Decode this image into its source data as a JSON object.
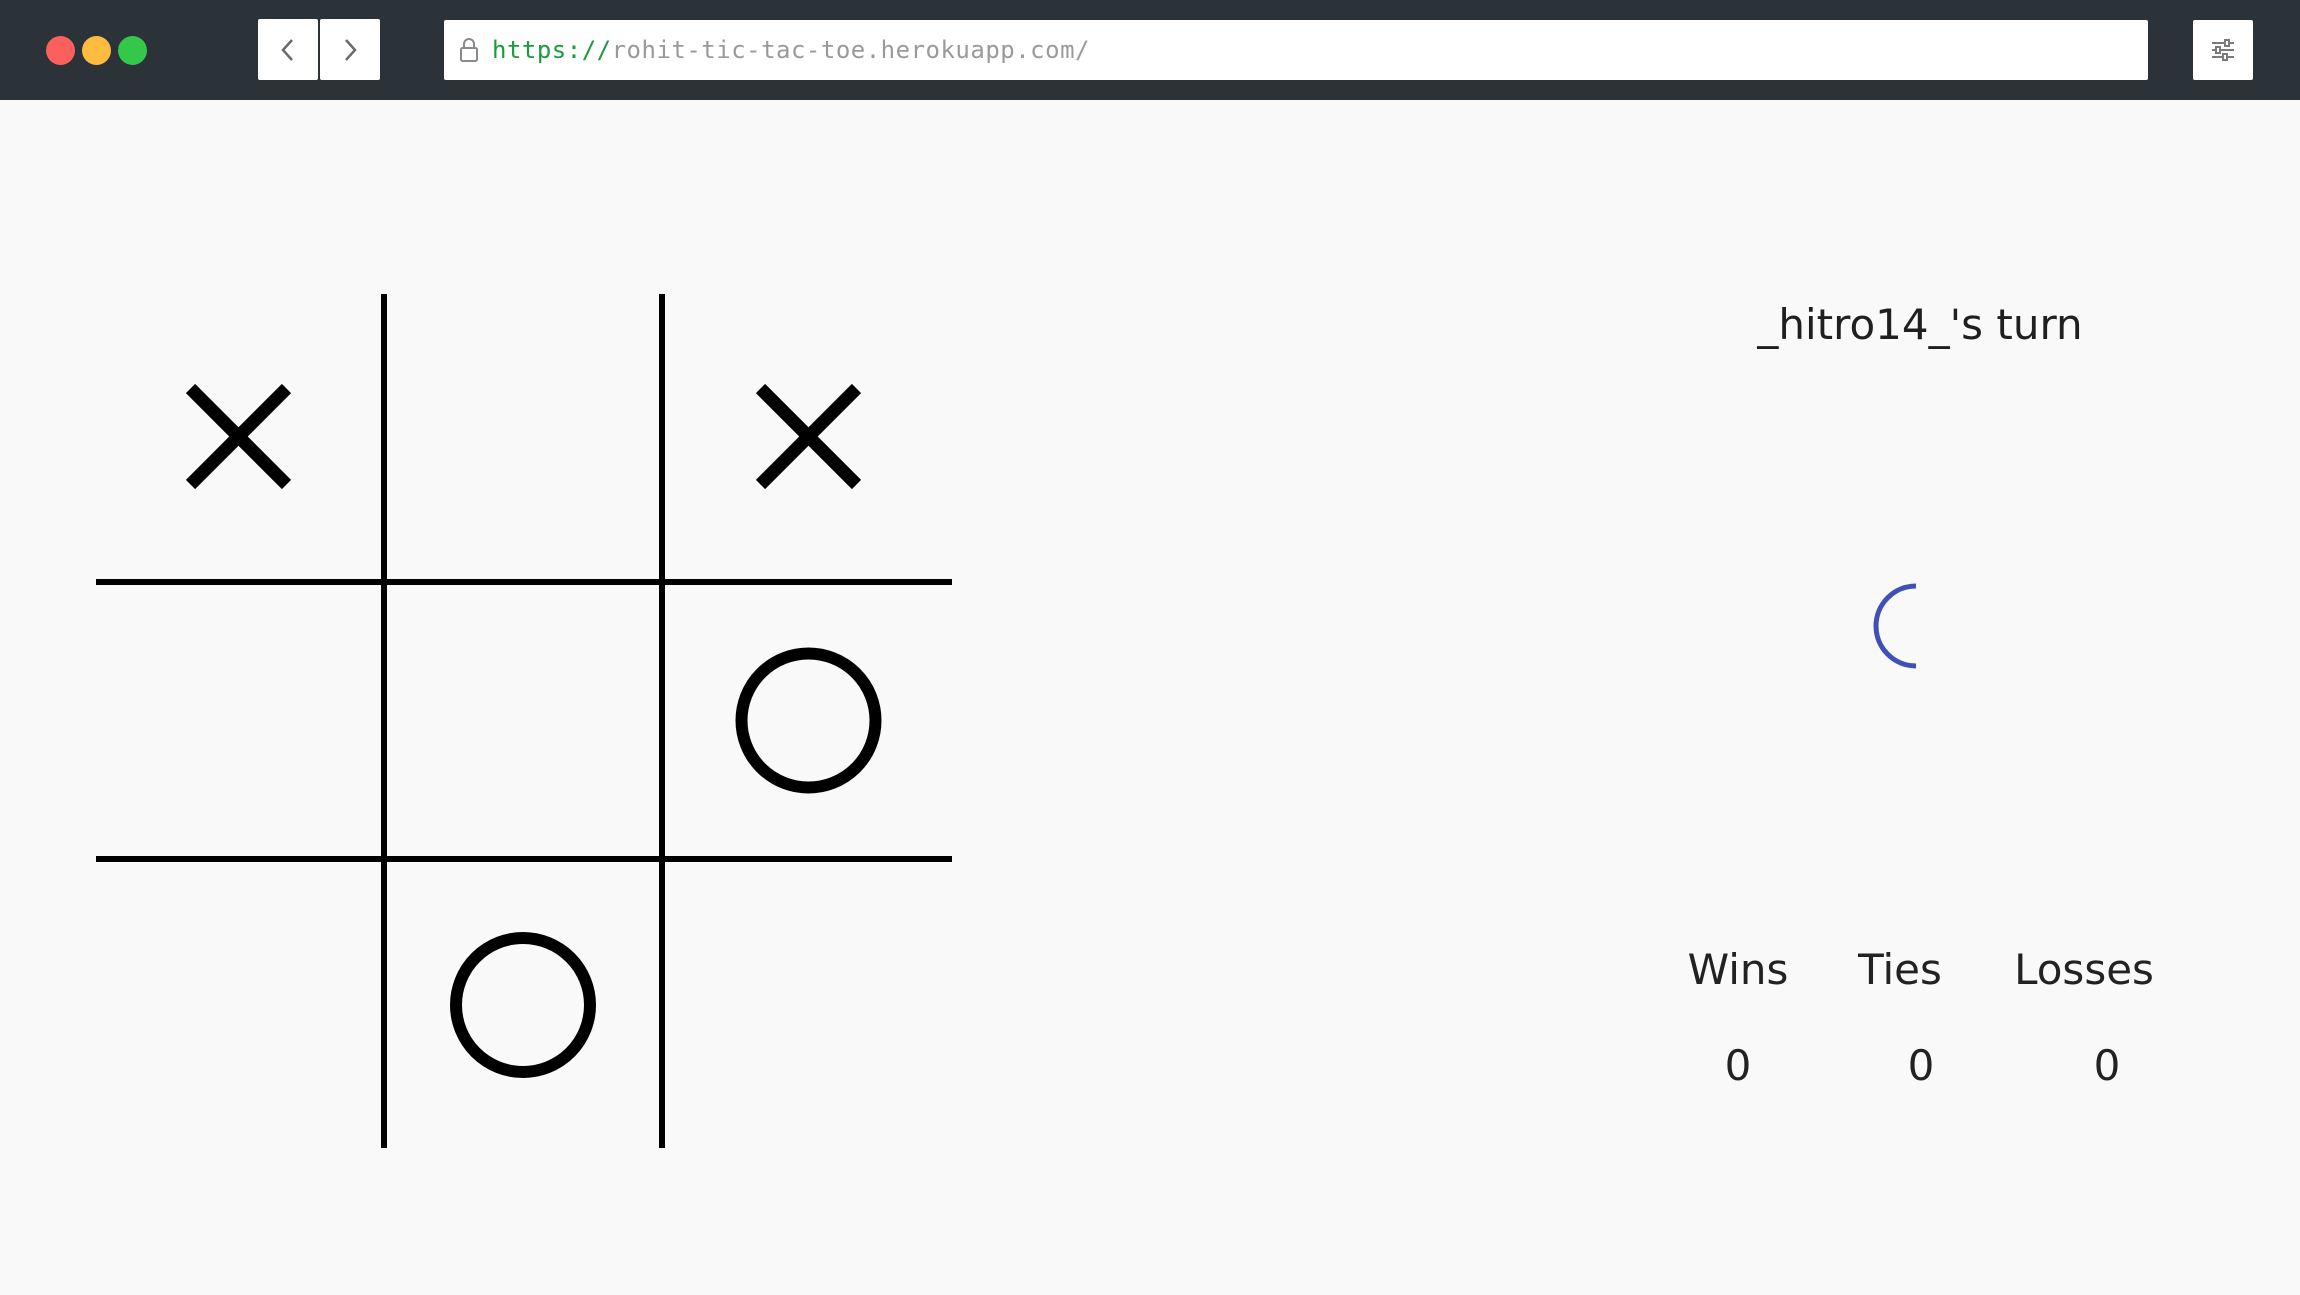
{
  "browser": {
    "url_scheme": "https://",
    "url_host": "rohit-tic-tac-toe.herokuapp.com/"
  },
  "board": {
    "cells": [
      "X",
      "",
      "X",
      "",
      "",
      "O",
      "",
      "O",
      ""
    ]
  },
  "status": {
    "turn_text": "_hitro14_'s turn",
    "spinner_color": "#3f51b5"
  },
  "scoreboard": {
    "wins_label": "Wins",
    "ties_label": "Ties",
    "losses_label": "Losses",
    "wins": "0",
    "ties": "0",
    "losses": "0"
  }
}
